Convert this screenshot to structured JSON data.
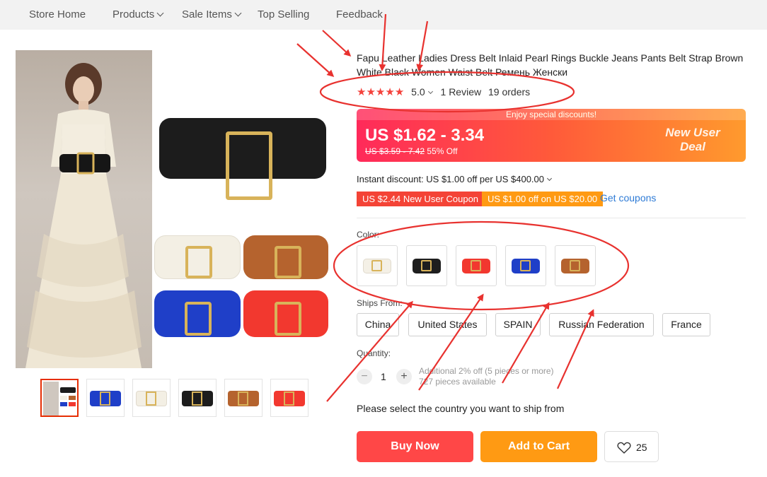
{
  "nav": {
    "items": [
      {
        "label": "Store Home",
        "has_dropdown": false
      },
      {
        "label": "Products",
        "has_dropdown": true
      },
      {
        "label": "Sale Items",
        "has_dropdown": true
      },
      {
        "label": "Top Selling",
        "has_dropdown": false
      },
      {
        "label": "Feedback",
        "has_dropdown": false
      }
    ]
  },
  "product": {
    "title": "Fapu Leather Ladies Dress Belt Inlaid Pearl Rings Buckle Jeans Pants Belt Strap Brown White Black Women Waist Belt Ремень Женски",
    "rating": "5.0",
    "stars": 5,
    "reviews": "1 Review",
    "orders": "19 orders"
  },
  "price": {
    "banner": "Enjoy special discounts!",
    "current": "US $1.62 - 3.34",
    "original": "US $3.59 - 7.42",
    "discount": "55% Off",
    "promo_badge": "New User Deal",
    "instant_discount": "Instant discount: US $1.00 off per US $400.00"
  },
  "coupons": {
    "items": [
      "US $2.44 New User Coupon",
      "US $1.00 off on US $20.00"
    ],
    "colors": [
      "#f44336",
      "#ff9a13"
    ],
    "get_label": "Get coupons"
  },
  "color": {
    "label": "Color:",
    "options": [
      {
        "name": "white",
        "hex": "#f4f0e6"
      },
      {
        "name": "black",
        "hex": "#1e1e1e"
      },
      {
        "name": "red",
        "hex": "#f2382f"
      },
      {
        "name": "blue",
        "hex": "#1f3fc8"
      },
      {
        "name": "brown",
        "hex": "#b5632e"
      }
    ]
  },
  "ships": {
    "label": "Ships From:",
    "options": [
      "China",
      "United States",
      "SPAIN",
      "Russian Federation",
      "France"
    ]
  },
  "quantity": {
    "label": "Quantity:",
    "value": "1",
    "minus": "−",
    "plus": "+",
    "note": "Additional 2% off (5 pieces or more)",
    "available": "727 pieces available"
  },
  "select_country": "Please select the country you want to ship from",
  "actions": {
    "buy_now": "Buy Now",
    "add_to_cart": "Add to Cart",
    "wishlist_count": "25"
  },
  "thumbnails": [
    "model",
    "blue",
    "white",
    "black",
    "brown",
    "red"
  ],
  "accent": {
    "red": "#ff4747",
    "orange": "#ff9a13",
    "link": "#2e7bd6",
    "annotation": "#e8322f"
  }
}
